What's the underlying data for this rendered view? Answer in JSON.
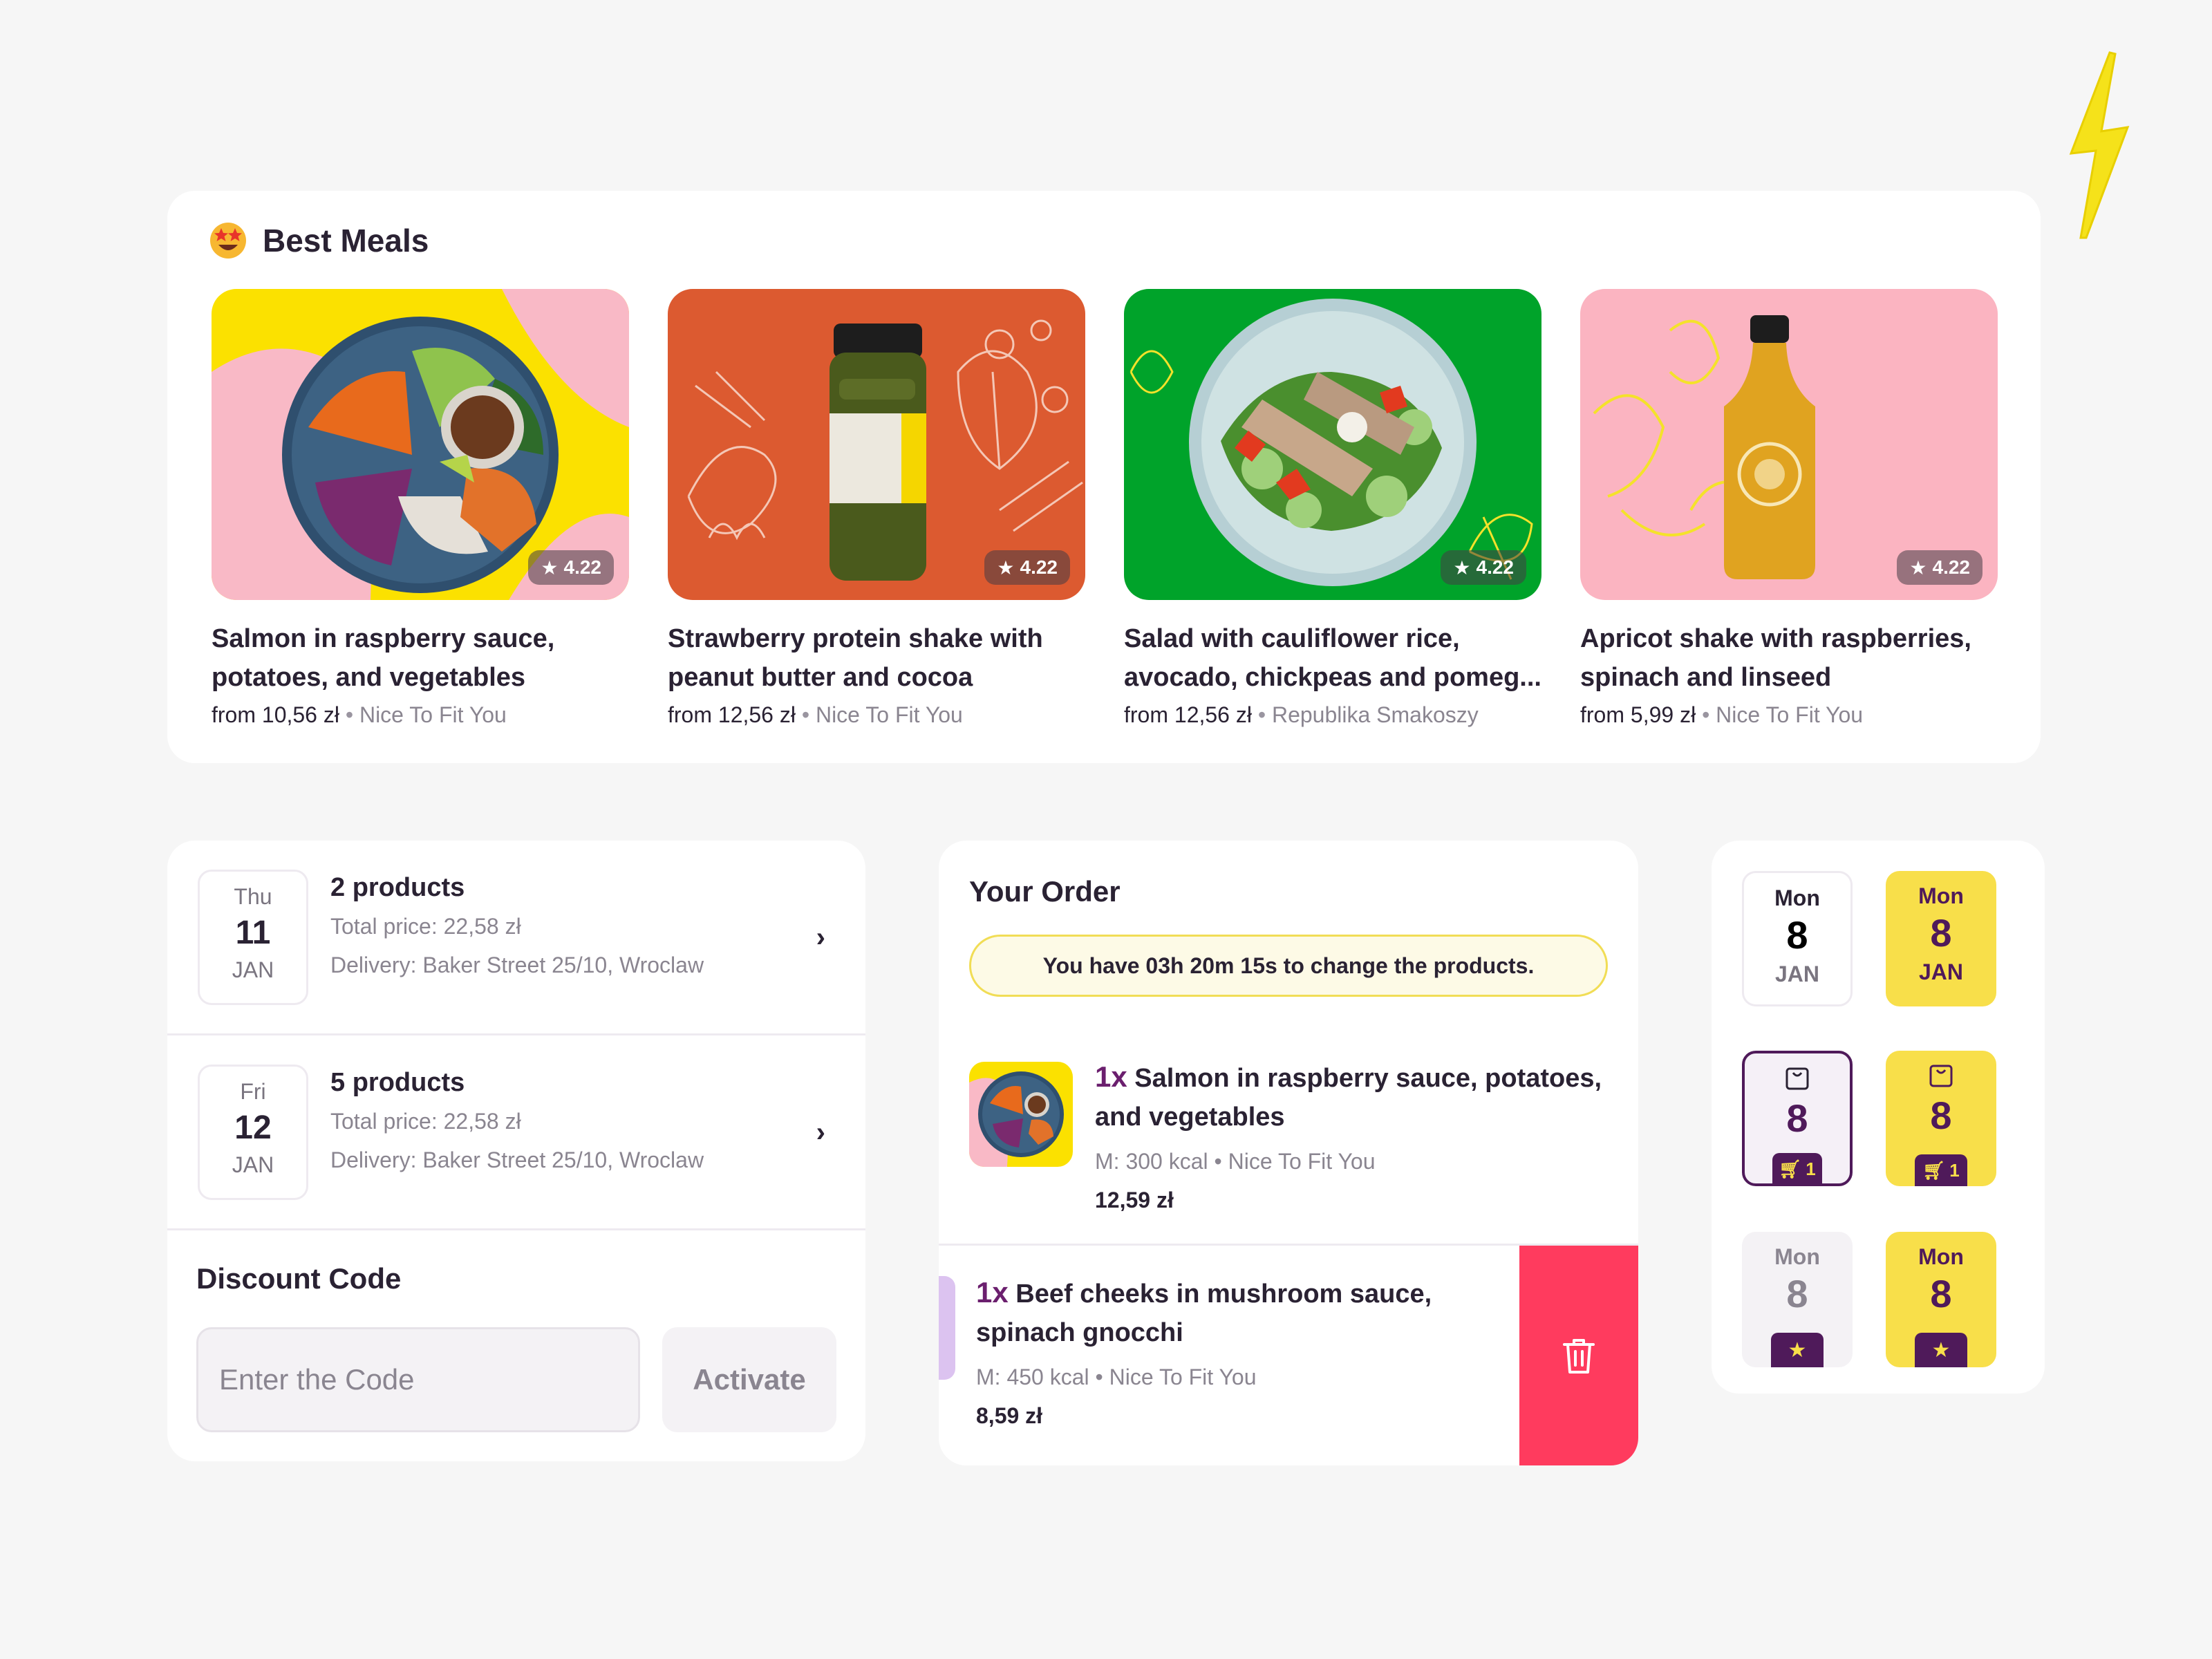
{
  "best_meals": {
    "title": "Best Meals",
    "items": [
      {
        "title": "Salmon in raspberry sauce, potatoes, and vegetables",
        "price": "from 10,56 zł",
        "vendor": "Nice To Fit You",
        "rating": "4.22"
      },
      {
        "title": "Strawberry protein shake with peanut butter and cocoa",
        "price": "from 12,56 zł",
        "vendor": "Nice To Fit You",
        "rating": "4.22"
      },
      {
        "title": "Salad with cauliflower rice, avocado, chickpeas and pomeg...",
        "price": "from 12,56 zł",
        "vendor": "Republika Smakoszy",
        "rating": "4.22"
      },
      {
        "title": "Apricot shake with raspberries, spinach and linseed",
        "price": "from 5,99 zł",
        "vendor": "Nice To Fit You",
        "rating": "4.22"
      }
    ]
  },
  "separator": "•",
  "orders": [
    {
      "weekday": "Thu",
      "day": "11",
      "month": "JAN",
      "products": "2 products",
      "total": "Total price: 22,58 zł",
      "delivery": "Delivery: Baker Street 25/10, Wroclaw"
    },
    {
      "weekday": "Fri",
      "day": "12",
      "month": "JAN",
      "products": "5 products",
      "total": "Total price: 22,58 zł",
      "delivery": "Delivery: Baker Street 25/10, Wroclaw"
    }
  ],
  "discount": {
    "label": "Discount Code",
    "placeholder": "Enter the Code",
    "button": "Activate"
  },
  "your_order": {
    "title": "Your Order",
    "timer": "You have 03h 20m 15s to change the products.",
    "items": [
      {
        "qty": "1x",
        "name": "Salmon in raspberry sauce, potatoes, and vegetables",
        "meta": "M: 300 kcal • Nice To Fit You",
        "price": "12,59 zł"
      },
      {
        "qty": "1x",
        "name": "Beef cheeks in mushroom sauce, spinach gnocchi",
        "meta": "M: 450 kcal • Nice To Fit You",
        "price": "8,59 zł"
      }
    ]
  },
  "tiles": [
    {
      "weekday": "Mon",
      "day": "8",
      "month": "JAN"
    },
    {
      "weekday": "Mon",
      "day": "8",
      "month": "JAN"
    },
    {
      "day": "8",
      "cart": "1"
    },
    {
      "day": "8",
      "cart": "1"
    },
    {
      "weekday": "Mon",
      "day": "8"
    },
    {
      "weekday": "Mon",
      "day": "8"
    }
  ],
  "colors": {
    "accent_purple": "#4f1a5a",
    "accent_yellow": "#f8df4a",
    "delete_red": "#ff3b5e"
  }
}
